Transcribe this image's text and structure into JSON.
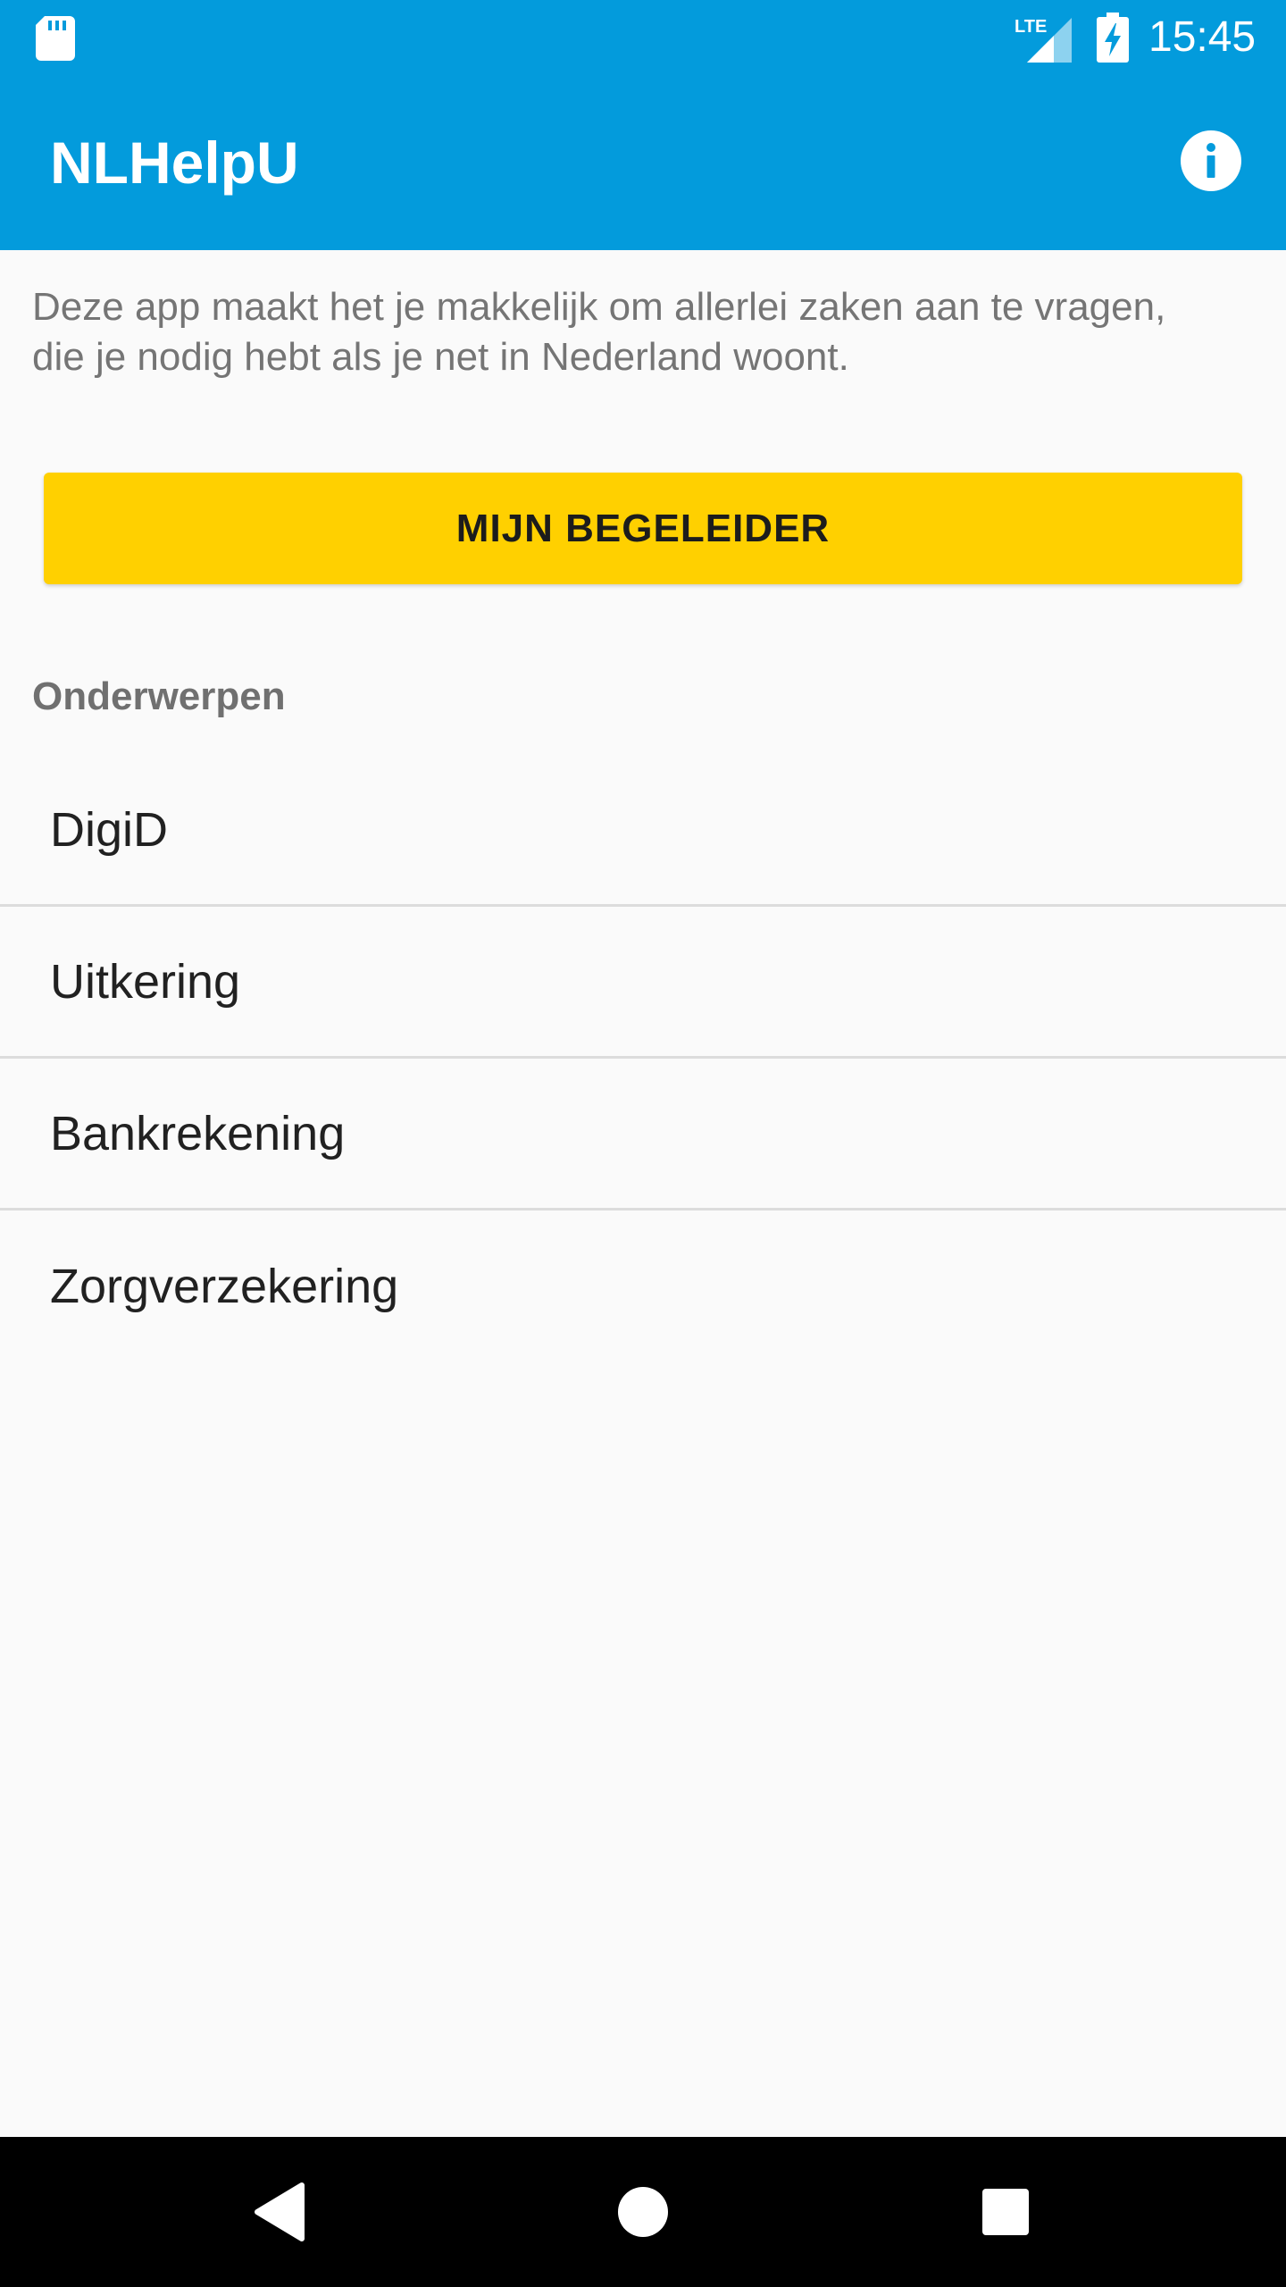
{
  "status_bar": {
    "time": "15:45",
    "network_label": "LTE",
    "icons": [
      "sd-card-icon",
      "lte-signal-icon",
      "battery-charging-icon"
    ]
  },
  "app_bar": {
    "title": "NLHelpU",
    "info_icon": "info-icon"
  },
  "intro": {
    "text": "Deze app maakt het je makkelijk om allerlei zaken aan te vragen, die je nodig hebt als je net in Nederland woont."
  },
  "primary_button": {
    "label": "MIJN BEGELEIDER"
  },
  "topics": {
    "heading": "Onderwerpen",
    "items": [
      {
        "label": "DigiD"
      },
      {
        "label": "Uitkering"
      },
      {
        "label": "Bankrekening"
      },
      {
        "label": "Zorgverzekering"
      }
    ]
  },
  "nav_bar": {
    "icons": [
      "back-icon",
      "home-icon",
      "recents-icon"
    ]
  },
  "colors": {
    "primary": "#039bdc",
    "accent": "#ffd000",
    "background": "#fafafa",
    "divider": "#dcdcdc",
    "secondary_text": "#757575"
  }
}
